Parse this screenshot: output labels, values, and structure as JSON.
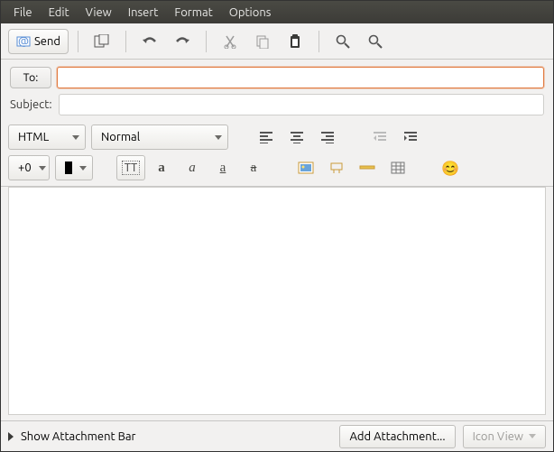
{
  "menubar": {
    "file": "File",
    "edit": "Edit",
    "view": "View",
    "insert": "Insert",
    "format": "Format",
    "options": "Options"
  },
  "toolbar": {
    "send_label": "Send"
  },
  "fields": {
    "to_label": "To:",
    "to_value": "",
    "subject_label": "Subject:",
    "subject_value": ""
  },
  "format": {
    "mode": "HTML",
    "paragraph": "Normal",
    "font_size": "+0"
  },
  "attach": {
    "show_bar": "Show Attachment Bar",
    "add_btn": "Add Attachment...",
    "view_mode": "Icon View"
  }
}
